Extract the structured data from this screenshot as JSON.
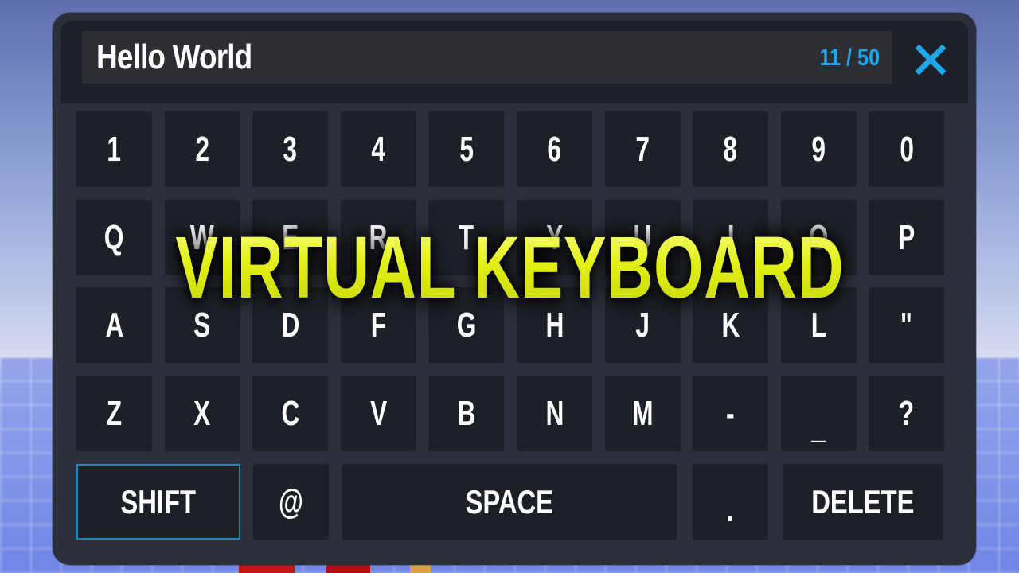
{
  "input": {
    "value": "Hello World",
    "counter": "11 / 50"
  },
  "icons": {
    "close": "close-icon"
  },
  "colors": {
    "accent": "#1da6ea",
    "panel": "#2b2f39",
    "key": "#1d2027",
    "title": "#e6f21a",
    "selected_border": "#1f87b6"
  },
  "keyboard": {
    "row1": [
      "1",
      "2",
      "3",
      "4",
      "5",
      "6",
      "7",
      "8",
      "9",
      "0"
    ],
    "row2": [
      "Q",
      "W",
      "E",
      "R",
      "T",
      "Y",
      "U",
      "I",
      "O",
      "P"
    ],
    "row3": [
      "A",
      "S",
      "D",
      "F",
      "G",
      "H",
      "J",
      "K",
      "L",
      "\""
    ],
    "row4": [
      "Z",
      "X",
      "C",
      "V",
      "B",
      "N",
      "M",
      "-",
      "_",
      "?"
    ],
    "row5": [
      "SHIFT",
      "@",
      "SPACE",
      ".",
      "DELETE"
    ],
    "selected": "SHIFT"
  },
  "overlay": {
    "title": "VIRTUAL KEYBOARD"
  }
}
